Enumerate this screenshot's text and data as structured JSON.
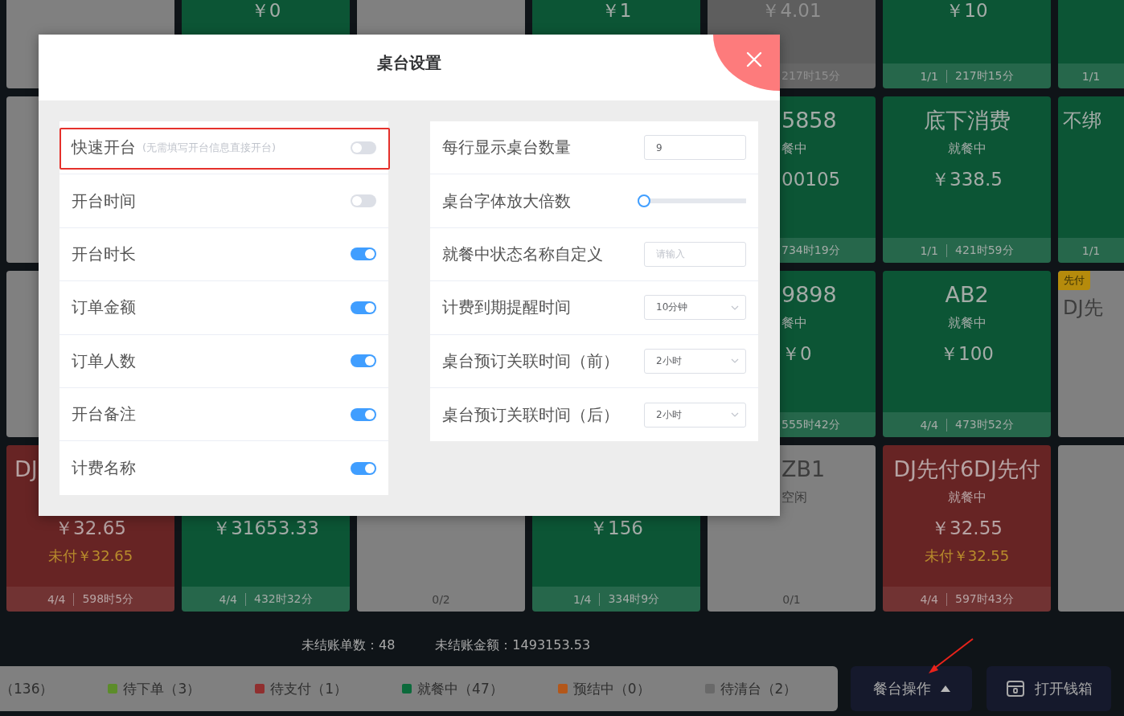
{
  "table_grid": {
    "rows": [
      {
        "tiles": [
          {
            "kind": "idle"
          },
          {
            "kind": "dining",
            "amount": "￥0"
          },
          {
            "kind": "idle"
          },
          {
            "kind": "dining",
            "amount": "￥1"
          },
          {
            "kind": "to_clean",
            "amount": "￥4.01",
            "duration": "217时15分"
          },
          {
            "kind": "dining",
            "amount": "￥10",
            "seats": "1/1",
            "duration": "217时15分"
          },
          {
            "kind": "dining",
            "seats": "1/1"
          }
        ]
      },
      {
        "tiles": [
          {
            "kind": "idle"
          },
          {
            "kind": "dining",
            "title": "5858",
            "status": "餐中",
            "amount": "00105",
            "duration": "734时19分"
          },
          {
            "kind": "dining",
            "title": "底下消费",
            "status": "就餐中",
            "amount": "￥338.5",
            "seats": "1/1",
            "duration": "421时59分"
          },
          {
            "kind": "dining",
            "title": "不绑",
            "seats": "1/1"
          }
        ]
      },
      {
        "tiles": [
          {
            "kind": "idle"
          },
          {
            "kind": "dining",
            "title": "9898",
            "status": "餐中",
            "amount": "￥0",
            "duration": "555时42分"
          },
          {
            "kind": "dining",
            "title": "AB2",
            "status": "就餐中",
            "amount": "￥100",
            "seats": "4/4",
            "duration": "473时52分"
          },
          {
            "kind": "idle",
            "badge": "先付",
            "title": "DJ先"
          }
        ]
      },
      {
        "tiles": [
          {
            "kind": "unpaid",
            "title": "DJ",
            "amount": "￥32.65",
            "unpaid": "未付￥32.65",
            "seats": "4/4",
            "duration": "598时5分"
          },
          {
            "kind": "dining",
            "amount": "￥31653.33",
            "seats": "4/4",
            "duration": "432时32分"
          },
          {
            "kind": "idle",
            "seats": "0/2"
          },
          {
            "kind": "dining",
            "amount": "￥156",
            "seats": "1/4",
            "duration": "334时9分"
          },
          {
            "kind": "idle",
            "title": "ZB1",
            "status": "空闲",
            "seats": "0/1"
          },
          {
            "kind": "unpaid",
            "title": "DJ先付6DJ先付",
            "status": "就餐中",
            "amount": "￥32.55",
            "unpaid": "未付￥32.55",
            "seats": "4/4",
            "duration": "597时43分"
          },
          {
            "kind": "idle"
          }
        ]
      }
    ]
  },
  "summary": [
    "未结账单数：48",
    "未结账金额：1493153.53"
  ],
  "status_legend": [
    {
      "label": "（136）"
    },
    {
      "label": "待下单（3）",
      "color": "#5c8c2a"
    },
    {
      "label": "待支付（1）",
      "color": "#902f2f"
    },
    {
      "label": "就餐中（47）",
      "color": "#0b6a3b"
    },
    {
      "label": "预结中（0）",
      "color": "#b3571a"
    },
    {
      "label": "待清台（2）",
      "color": "#696969"
    }
  ],
  "actions": [
    {
      "label": "餐台操作",
      "kind": "menu",
      "annotated": true
    },
    {
      "label": "打开钱箱",
      "kind": "cash_drawer",
      "annotated": false
    }
  ],
  "dialog": {
    "title": "桌台设置",
    "left_settings": [
      {
        "label": "快速开台",
        "hint": "(无需填写开台信息直接开台)",
        "on": false,
        "highlighted": true
      },
      {
        "label": "开台时间",
        "on": false,
        "highlighted": false
      },
      {
        "label": "开台时长",
        "on": true,
        "highlighted": false
      },
      {
        "label": "订单金额",
        "on": true,
        "highlighted": false
      },
      {
        "label": "订单人数",
        "on": true,
        "highlighted": false
      },
      {
        "label": "开台备注",
        "on": true,
        "highlighted": false
      },
      {
        "label": "计费名称",
        "on": true,
        "highlighted": false
      }
    ],
    "right_settings": [
      {
        "label": "每行显示桌台数量",
        "kind": "input",
        "value": "9"
      },
      {
        "label": "桌台字体放大倍数",
        "kind": "slider",
        "level": 0
      },
      {
        "label": "就餐中状态名称自定义",
        "kind": "input",
        "placeholder": "请输入"
      },
      {
        "label": "计费到期提醒时间",
        "kind": "select",
        "value": "10分钟"
      },
      {
        "label": "桌台预订关联时间（前）",
        "kind": "select",
        "value": "2小时"
      },
      {
        "label": "桌台预订关联时间（后）",
        "kind": "select",
        "value": "2小时"
      }
    ]
  }
}
